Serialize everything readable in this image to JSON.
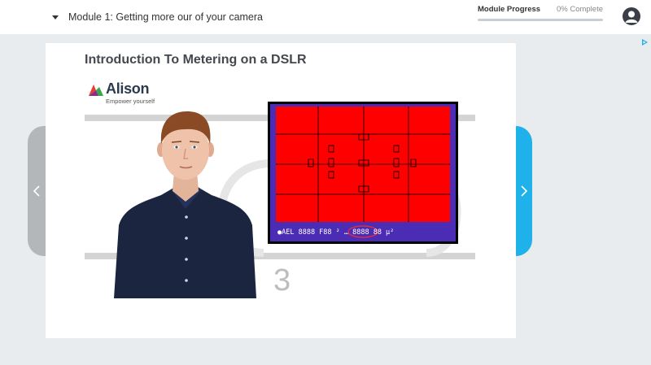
{
  "header": {
    "module_title": "Module 1: Getting more our of your camera",
    "progress_label": "Module Progress",
    "progress_text": "0% Complete",
    "progress_value": 0
  },
  "lesson": {
    "title": "Introduction To Metering on a DSLR",
    "slide_number": "3"
  },
  "logo": {
    "name": "Alison",
    "tagline": "Empower yourself"
  },
  "viewfinder": {
    "readout": "●AEL 8888 F88 ² … 8888 88 µ²"
  },
  "colors": {
    "accent": "#1fb1ea",
    "viewfinder_red": "#ff0000",
    "viewfinder_frame": "#4a2cb5",
    "progress_track": "#c9ced4"
  },
  "icons": {
    "module_toggle": "caret-down-icon",
    "user": "user-icon",
    "prev": "chevron-left-icon",
    "next": "chevron-right-icon",
    "ad": "ad-choices-icon"
  }
}
